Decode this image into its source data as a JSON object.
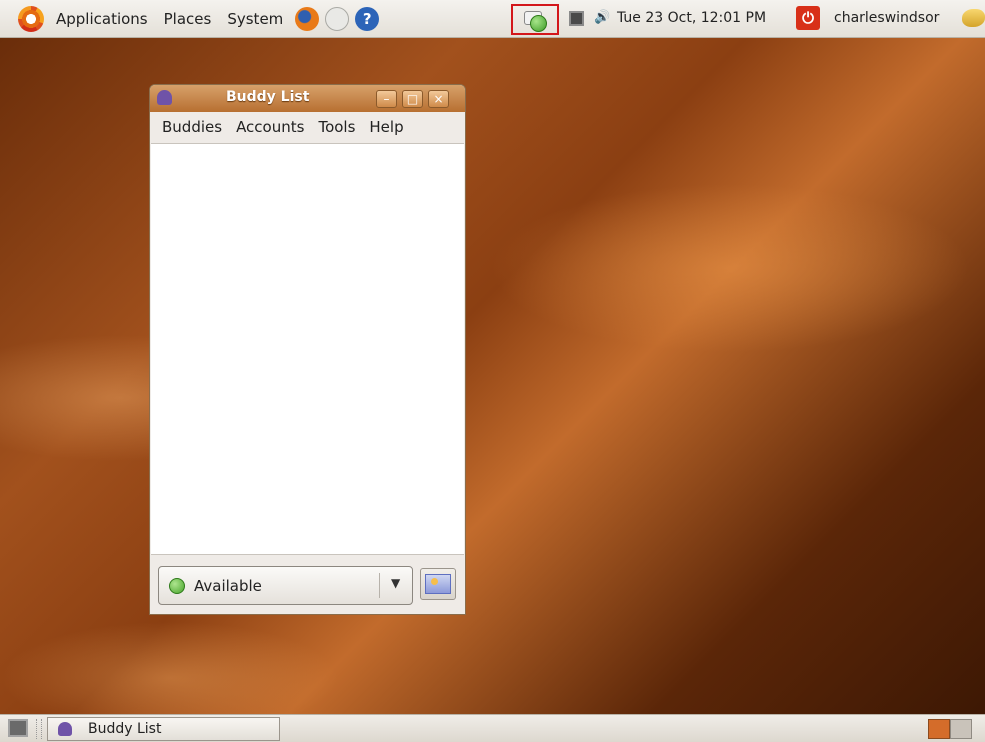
{
  "top_panel": {
    "menus": [
      "Applications",
      "Places",
      "System"
    ],
    "clock": "Tue 23 Oct, 12:01 PM",
    "username": "charleswindsor"
  },
  "buddy_window": {
    "title": "Buddy List",
    "menus": [
      "Buddies",
      "Accounts",
      "Tools",
      "Help"
    ],
    "status": "Available"
  },
  "bottom_panel": {
    "task_label": "Buddy List"
  },
  "colors": {
    "accent": "#b76f31",
    "status_available": "#47a42a"
  },
  "icons": [
    "ubuntu-logo-icon",
    "firefox-icon",
    "mail-icon",
    "help-icon",
    "pidgin-tray-icon",
    "network-icon",
    "volume-icon",
    "power-icon",
    "user-switcher-icon"
  ]
}
